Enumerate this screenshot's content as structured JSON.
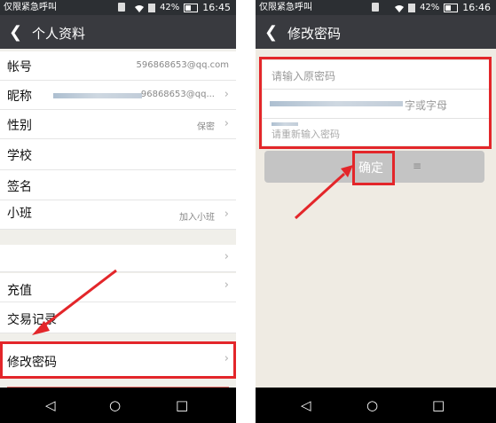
{
  "left": {
    "status": {
      "carrier": "仅限紧急呼叫",
      "battery": "42%",
      "time": "16:45"
    },
    "title": "个人资料",
    "rows": [
      {
        "label": "帐号",
        "value": "596868653@qq.com"
      },
      {
        "label": "昵称",
        "value": "96868653@qq..."
      },
      {
        "label": "性别",
        "value": "保密"
      },
      {
        "label": "学校",
        "value": ""
      },
      {
        "label": "签名",
        "value": ""
      },
      {
        "label": "小班",
        "value": "加入小班"
      }
    ],
    "rows2": [
      {
        "label": "充值"
      },
      {
        "label": "交易记录"
      },
      {
        "label": "修改密码"
      }
    ]
  },
  "right": {
    "status": {
      "carrier": "仅限紧急呼叫",
      "battery": "42%",
      "time": "16:46"
    },
    "title": "修改密码",
    "fields": {
      "old_password_placeholder": "请输入原密码",
      "new_password_hint_fragment": "字或字母",
      "confirm_password_placeholder": "请重新输入密码"
    },
    "confirm_label": "确定"
  }
}
